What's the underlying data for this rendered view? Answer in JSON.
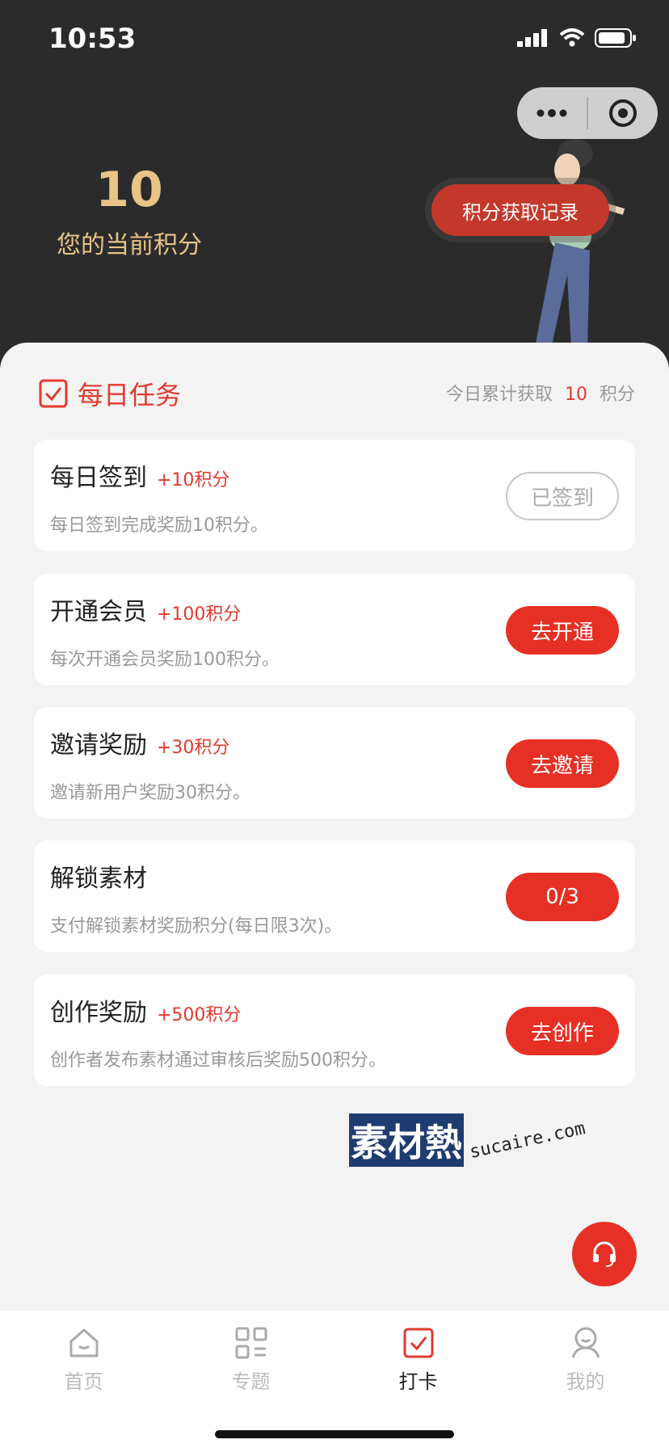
{
  "status_bar": {
    "time": "10:53"
  },
  "header": {
    "points_value": "10",
    "points_label": "您的当前积分",
    "record_button": "积分获取记录"
  },
  "daily": {
    "title": "每日任务",
    "summary_prefix": "今日累计获取",
    "summary_value": "10",
    "summary_suffix": "积分"
  },
  "tasks": [
    {
      "title": "每日签到",
      "bonus": "+10积分",
      "desc": "每日签到完成奖励10积分。",
      "button": "已签到"
    },
    {
      "title": "开通会员",
      "bonus": "+100积分",
      "desc": "每次开通会员奖励100积分。",
      "button": "去开通"
    },
    {
      "title": "邀请奖励",
      "bonus": "+30积分",
      "desc": "邀请新用户奖励30积分。",
      "button": "去邀请"
    },
    {
      "title": "解锁素材",
      "bonus": "",
      "desc": "支付解锁素材奖励积分(每日限3次)。",
      "button": "0/3"
    },
    {
      "title": "创作奖励",
      "bonus": "+500积分",
      "desc": "创作者发布素材通过审核后奖励500积分。",
      "button": "去创作"
    }
  ],
  "watermark": {
    "brand": "素材熱",
    "site": "sucaire.com"
  },
  "tabs": [
    {
      "label": "首页",
      "icon": "home-icon"
    },
    {
      "label": "专题",
      "icon": "grid-icon"
    },
    {
      "label": "打卡",
      "icon": "checkin-icon"
    },
    {
      "label": "我的",
      "icon": "profile-icon"
    }
  ],
  "colors": {
    "accent": "#e63025",
    "gold": "#e8c487",
    "header_bg": "#2b2b2b"
  }
}
